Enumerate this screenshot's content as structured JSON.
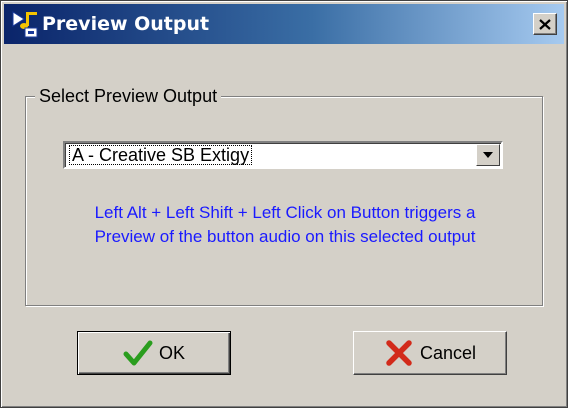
{
  "window": {
    "title": "Preview Output",
    "close_glyph": "✕",
    "title_icon": "audio-preview-icon"
  },
  "group": {
    "legend": "Select Preview Output"
  },
  "output_select": {
    "selected": "A  - Creative SB Extigy"
  },
  "hint": {
    "text": "Left Alt + Left Shift + Left Click on Button triggers a Preview of the button audio on this selected output",
    "color": "#1a1aff"
  },
  "buttons": {
    "ok": {
      "label": "OK",
      "icon": "checkmark-icon",
      "icon_color": "#2a9d1e"
    },
    "cancel": {
      "label": "Cancel",
      "icon": "x-mark-icon",
      "icon_color": "#d22a1a"
    }
  }
}
